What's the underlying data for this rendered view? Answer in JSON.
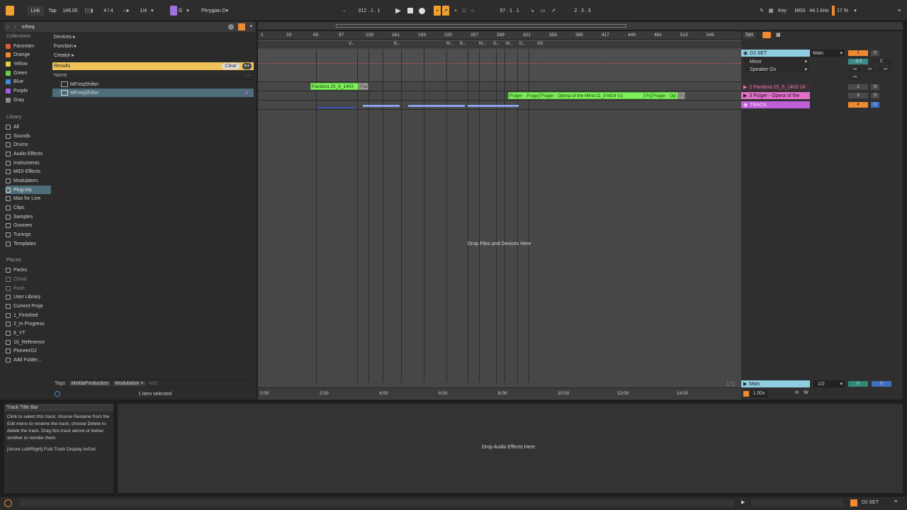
{
  "topbar": {
    "link": "Link",
    "tap": "Tap",
    "tempo": "146.00",
    "signature": "4 / 4",
    "quantize": "1/4",
    "key_root": "G",
    "scale": "Phrygian D",
    "position": "312 . 1 . 1",
    "loop_start": "57 . 1 . 1",
    "loop_length": "2 . 3 . 3",
    "key_label": "Key",
    "midi_label": "MIDI",
    "sample_rate": "44.1 kHz",
    "cpu": "17 %"
  },
  "browser": {
    "search_value": "mfreq",
    "collections_head": "Collections",
    "collections": [
      {
        "label": "Favoriten",
        "color": "#e05a3a"
      },
      {
        "label": "Orange",
        "color": "#f08a30"
      },
      {
        "label": "Yellow",
        "color": "#e8d048"
      },
      {
        "label": "Green",
        "color": "#6ccf4a"
      },
      {
        "label": "Blue",
        "color": "#3f8be0"
      },
      {
        "label": "Purple",
        "color": "#a05ee0"
      },
      {
        "label": "Gray",
        "color": "#8a8a8a"
      }
    ],
    "library_head": "Library",
    "library": [
      "All",
      "Sounds",
      "Drums",
      "Audio Effects",
      "Instruments",
      "MIDI Effects",
      "Modulators",
      "Plug-Ins",
      "Max for Live",
      "Clips",
      "Samples",
      "Grooves",
      "Tunings",
      "Templates"
    ],
    "places_head": "Places",
    "places": [
      "Packs",
      "Cloud",
      "Push",
      "User Library",
      "Current Proje",
      "1_Finished",
      "2_In Progress",
      "8_YT",
      "10_Reference",
      "PioneerDJ",
      "Add Folder..."
    ],
    "filters": [
      "Devices ▸",
      "Function ▸",
      "Creator ▸"
    ],
    "results_label": "Results",
    "clear_label": "Clear",
    "name_col": "Name",
    "files": [
      "MFreqShifter",
      "MFreqShifter"
    ],
    "tags_label": "Tags:",
    "tags": [
      "MeldaProduction",
      "Modulation ×"
    ],
    "add_tag": "Add...",
    "selection_status": "1 item selected"
  },
  "arrangement": {
    "ruler_ticks": [
      "1",
      "33",
      "65",
      "97",
      "129",
      "161",
      "193",
      "225",
      "257",
      "289",
      "321",
      "353",
      "385",
      "417",
      "449",
      "481",
      "513",
      "545"
    ],
    "locators": [
      "V...",
      "B...",
      "M...",
      "B...",
      "M...",
      "G...",
      "M...",
      "D...",
      "OS"
    ],
    "clips_row1": [
      "Pandora 25_6_1403",
      "Pand"
    ],
    "clips_row2": [
      "Psiger - Psige",
      "Psiger - Opera of the Mind 11_9 M24 V2",
      "Ps",
      "Psiger - Op",
      "Ps"
    ],
    "drop_hint": "Drop Files and Devices Here",
    "time_ticks": [
      "0:00",
      "2:00",
      "4:00",
      "6:00",
      "8:00",
      "10:00",
      "12:00",
      "14:00"
    ],
    "page_counter": "1/1"
  },
  "mixer": {
    "set_label": "Set",
    "tracks": [
      {
        "name": "DJ SET",
        "color": "#8fcde0",
        "number": "1",
        "output": "Main"
      },
      {
        "name": "2 Pandora 25_6_1403 24",
        "color": "#f07a9a",
        "number": "2"
      },
      {
        "name": "3 Psiger - Opera of the",
        "color": "#e070c8",
        "number": "3"
      },
      {
        "name": "TRACK",
        "color": "#c060d8",
        "number": "4"
      }
    ],
    "mixer_label": "Mixer",
    "speaker_label": "Speaker On",
    "volume": "-3.5",
    "pan": "C",
    "inf_values": [
      "-∞",
      "-∞",
      "-∞",
      "-∞"
    ],
    "solo": "S",
    "main_label": "Main",
    "main_routing": "1/2",
    "main_vol": "0",
    "main_vol2": "0",
    "zoom": "1.00x",
    "h_label": "H",
    "w_label": "W"
  },
  "info": {
    "title": "Track Title Bar",
    "body": "Click to select this track; choose Rename from the Edit menu to rename the track; choose Delete to delete the track. Drag this track above or below another to reorder them.",
    "shortcut": "[Arrow Left/Right] Fold Track Display In/Out"
  },
  "device_drop": "Drop Audio Effects Here",
  "status": {
    "set_name": "DJ SET"
  }
}
